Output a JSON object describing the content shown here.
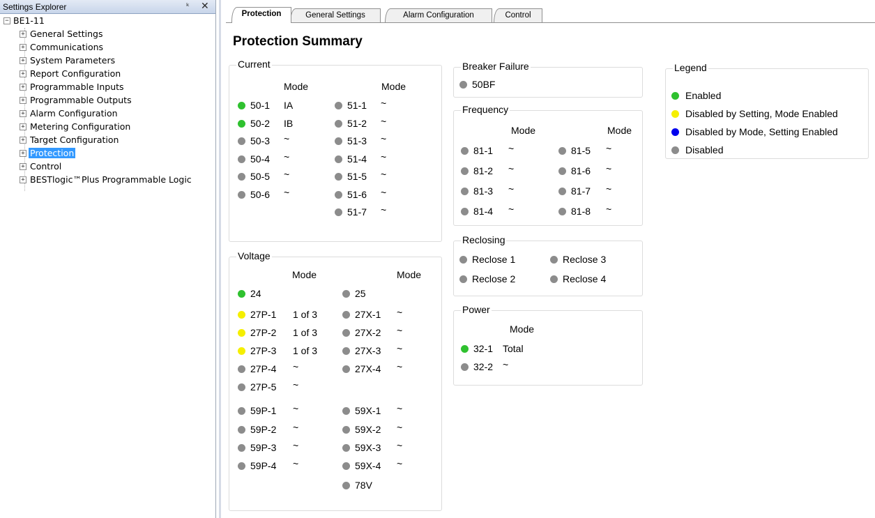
{
  "explorer": {
    "title": "Settings Explorer",
    "pin_glyph": "↕",
    "close_glyph": "✕",
    "root": "BE1-11",
    "items": [
      "General Settings",
      "Communications",
      "System Parameters",
      "Report Configuration",
      "Programmable Inputs",
      "Programmable Outputs",
      "Alarm Configuration",
      "Metering Configuration",
      "Target Configuration",
      "Protection",
      "Control",
      "BESTlogic™Plus Programmable Logic"
    ],
    "selected": "Protection"
  },
  "tabs": [
    "Protection",
    "General Settings",
    "Alarm Configuration",
    "Control"
  ],
  "page_title": "Protection Summary",
  "colors": {
    "enabled": "#2fc12f",
    "disabled_by_setting": "#f5ef00",
    "disabled_by_mode": "#0000ee",
    "disabled": "#8c8c8c",
    "selection": "#3399ff"
  },
  "current": {
    "title": "Current",
    "mode_header": "Mode",
    "left": [
      {
        "name": "50-1",
        "mode": "IA",
        "status": "green"
      },
      {
        "name": "50-2",
        "mode": "IB",
        "status": "green"
      },
      {
        "name": "50-3",
        "mode": "~",
        "status": "gray"
      },
      {
        "name": "50-4",
        "mode": "~",
        "status": "gray"
      },
      {
        "name": "50-5",
        "mode": "~",
        "status": "gray"
      },
      {
        "name": "50-6",
        "mode": "~",
        "status": "gray"
      }
    ],
    "right": [
      {
        "name": "51-1",
        "mode": "~",
        "status": "gray"
      },
      {
        "name": "51-2",
        "mode": "~",
        "status": "gray"
      },
      {
        "name": "51-3",
        "mode": "~",
        "status": "gray"
      },
      {
        "name": "51-4",
        "mode": "~",
        "status": "gray"
      },
      {
        "name": "51-5",
        "mode": "~",
        "status": "gray"
      },
      {
        "name": "51-6",
        "mode": "~",
        "status": "gray"
      },
      {
        "name": "51-7",
        "mode": "~",
        "status": "gray"
      }
    ]
  },
  "voltage": {
    "title": "Voltage",
    "mode_header": "Mode",
    "left": [
      {
        "name": "24",
        "mode": "",
        "status": "green"
      },
      {
        "name": "27P-1",
        "mode": "1 of 3",
        "status": "yellow"
      },
      {
        "name": "27P-2",
        "mode": "1 of 3",
        "status": "yellow"
      },
      {
        "name": "27P-3",
        "mode": "1 of 3",
        "status": "yellow"
      },
      {
        "name": "27P-4",
        "mode": "~",
        "status": "gray"
      },
      {
        "name": "27P-5",
        "mode": "~",
        "status": "gray"
      },
      {
        "name": "59P-1",
        "mode": "~",
        "status": "gray"
      },
      {
        "name": "59P-2",
        "mode": "~",
        "status": "gray"
      },
      {
        "name": "59P-3",
        "mode": "~",
        "status": "gray"
      },
      {
        "name": "59P-4",
        "mode": "~",
        "status": "gray"
      }
    ],
    "right": [
      {
        "name": "25",
        "mode": "",
        "status": "gray"
      },
      {
        "name": "27X-1",
        "mode": "~",
        "status": "gray"
      },
      {
        "name": "27X-2",
        "mode": "~",
        "status": "gray"
      },
      {
        "name": "27X-3",
        "mode": "~",
        "status": "gray"
      },
      {
        "name": "27X-4",
        "mode": "~",
        "status": "gray"
      },
      {
        "name": "59X-1",
        "mode": "~",
        "status": "gray"
      },
      {
        "name": "59X-2",
        "mode": "~",
        "status": "gray"
      },
      {
        "name": "59X-3",
        "mode": "~",
        "status": "gray"
      },
      {
        "name": "59X-4",
        "mode": "~",
        "status": "gray"
      },
      {
        "name": "78V",
        "mode": "",
        "status": "gray"
      }
    ]
  },
  "breaker_failure": {
    "title": "Breaker Failure",
    "items": [
      {
        "name": "50BF",
        "status": "gray"
      }
    ]
  },
  "frequency": {
    "title": "Frequency",
    "mode_header": "Mode",
    "left": [
      {
        "name": "81-1",
        "mode": "~",
        "status": "gray"
      },
      {
        "name": "81-2",
        "mode": "~",
        "status": "gray"
      },
      {
        "name": "81-3",
        "mode": "~",
        "status": "gray"
      },
      {
        "name": "81-4",
        "mode": "~",
        "status": "gray"
      }
    ],
    "right": [
      {
        "name": "81-5",
        "mode": "~",
        "status": "gray"
      },
      {
        "name": "81-6",
        "mode": "~",
        "status": "gray"
      },
      {
        "name": "81-7",
        "mode": "~",
        "status": "gray"
      },
      {
        "name": "81-8",
        "mode": "~",
        "status": "gray"
      }
    ]
  },
  "reclosing": {
    "title": "Reclosing",
    "items": [
      {
        "name": "Reclose 1",
        "status": "gray"
      },
      {
        "name": "Reclose 3",
        "status": "gray"
      },
      {
        "name": "Reclose 2",
        "status": "gray"
      },
      {
        "name": "Reclose 4",
        "status": "gray"
      }
    ]
  },
  "power": {
    "title": "Power",
    "mode_header": "Mode",
    "items": [
      {
        "name": "32-1",
        "mode": "Total",
        "status": "green"
      },
      {
        "name": "32-2",
        "mode": "~",
        "status": "gray"
      }
    ]
  },
  "legend": {
    "title": "Legend",
    "items": [
      {
        "label": "Enabled",
        "status": "green"
      },
      {
        "label": "Disabled by Setting, Mode Enabled",
        "status": "yellow"
      },
      {
        "label": "Disabled by Mode, Setting Enabled",
        "status": "blue"
      },
      {
        "label": "Disabled",
        "status": "gray"
      }
    ]
  }
}
